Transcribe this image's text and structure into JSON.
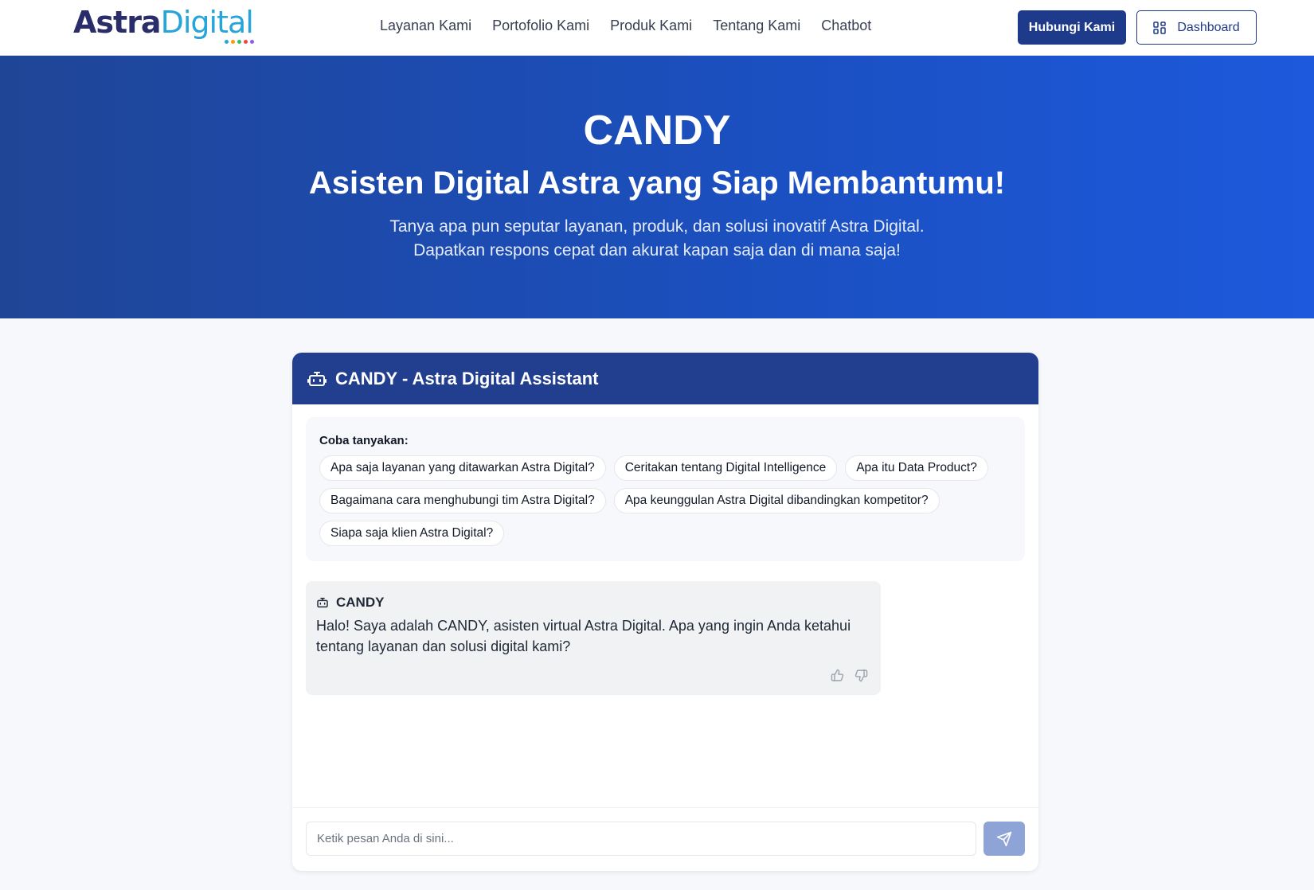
{
  "header": {
    "logo": {
      "part1": "Astra",
      "part2": "Digital",
      "dot_colors": [
        "#27a4d8",
        "#f59e0b",
        "#22c55e",
        "#ef4444",
        "#8b5cf6"
      ]
    },
    "nav": [
      "Layanan Kami",
      "Portofolio Kami",
      "Produk Kami",
      "Tentang Kami",
      "Chatbot"
    ],
    "contact_label": "Hubungi Kami",
    "dashboard_label": "Dashboard"
  },
  "hero": {
    "title": "CANDY",
    "subtitle": "Asisten Digital Astra yang Siap Membantumu!",
    "desc_line1": "Tanya apa pun seputar layanan, produk, dan solusi inovatif Astra Digital.",
    "desc_line2": "Dapatkan respons cepat dan akurat kapan saja dan di mana saja!"
  },
  "chat": {
    "title": "CANDY - Astra Digital Assistant",
    "header_icon": "robot-icon",
    "suggestions_label": "Coba tanyakan:",
    "suggestions": [
      "Apa saja layanan yang ditawarkan Astra Digital?",
      "Ceritakan tentang Digital Intelligence",
      "Apa itu Data Product?",
      "Bagaimana cara menghubungi tim Astra Digital?",
      "Apa keunggulan Astra Digital dibandingkan kompetitor?",
      "Siapa saja klien Astra Digital?"
    ],
    "messages": [
      {
        "sender": "CANDY",
        "text": "Halo! Saya adalah CANDY, asisten virtual Astra Digital. Apa yang ingin Anda ketahui tentang layanan dan solusi digital kami?"
      }
    ],
    "input_placeholder": "Ketik pesan Anda di sini...",
    "send_icon": "send-icon"
  },
  "colors": {
    "primary": "#1e3a8a",
    "hero_gradient_start": "#1f4596",
    "hero_gradient_end": "#1d59dc",
    "send_disabled": "#8ea4d6"
  }
}
